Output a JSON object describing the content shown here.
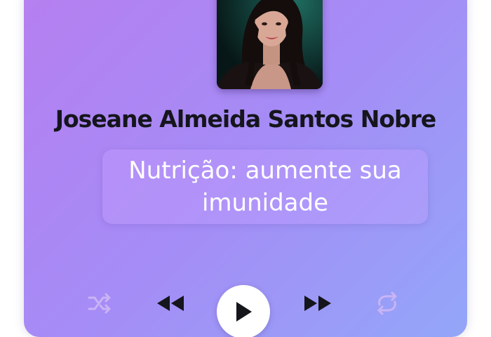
{
  "player": {
    "presenter_name": "Joseane Almeida Santos Nobre",
    "episode_title": "Nutrição: aumente sua imunidade"
  },
  "controls": {
    "shuffle_icon": "shuffle-icon",
    "previous_icon": "rewind-icon",
    "play_icon": "play-icon",
    "next_icon": "fast-forward-icon",
    "repeat_icon": "repeat-icon"
  },
  "colors": {
    "gradient_start": "#b67ff0",
    "gradient_end": "#93a6f8",
    "name_text": "#15151c",
    "title_text": "#ffffff"
  }
}
